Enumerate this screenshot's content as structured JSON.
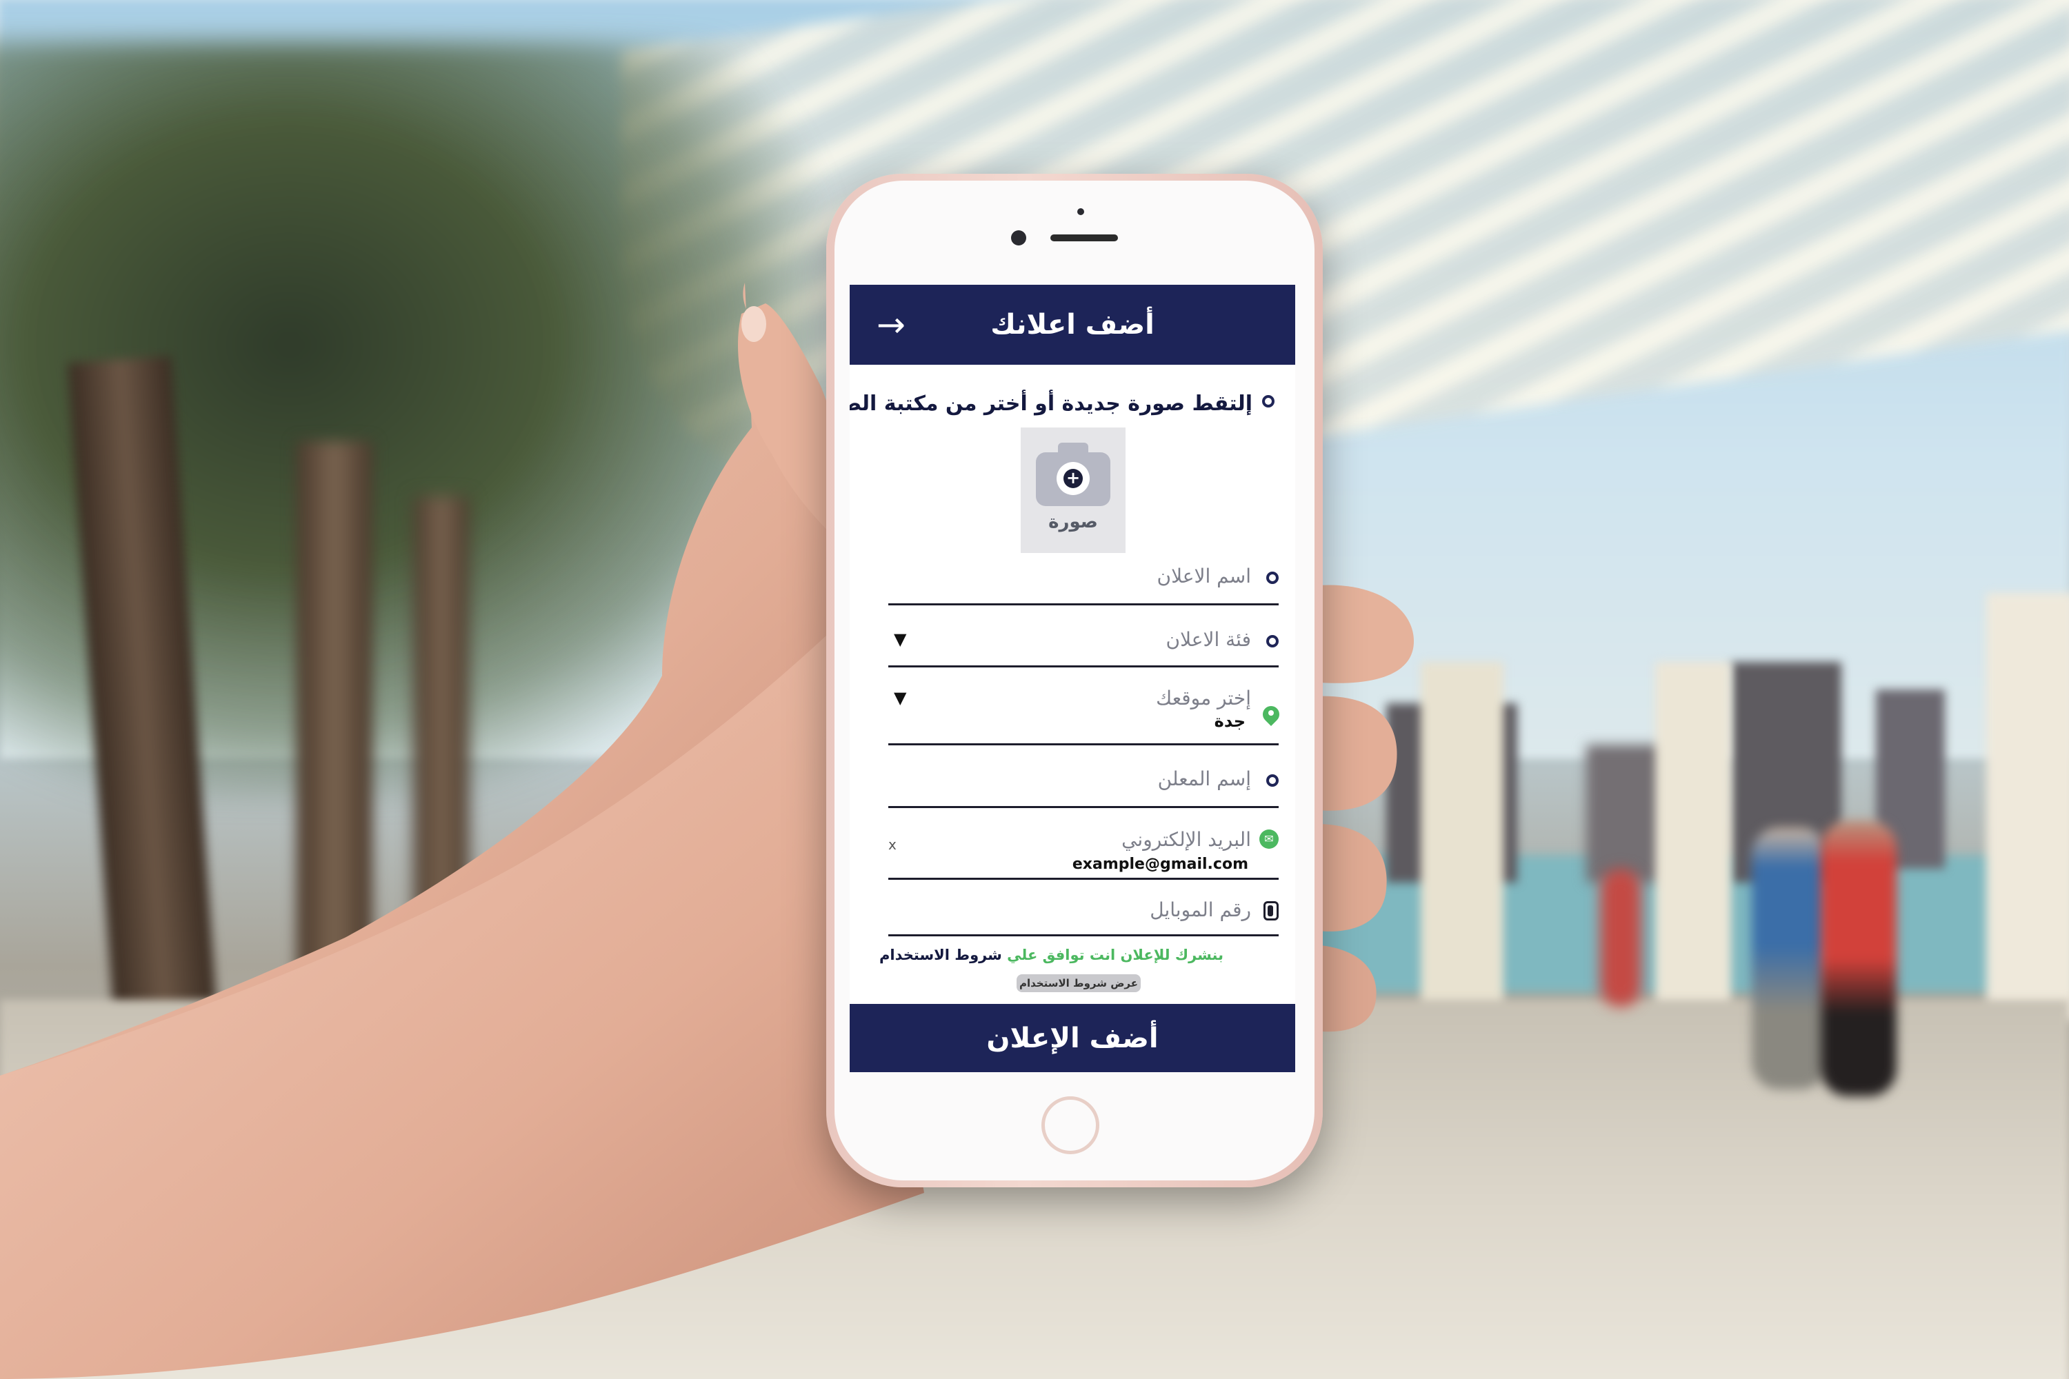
{
  "app": {
    "header_title": "أضف اعلانك",
    "back_icon": "arrow-right-icon"
  },
  "photo": {
    "instruction": "إلتقط صورة جديدة أو أختر من مكتبة الصور",
    "button_label": "صورة",
    "icon": "camera-plus-icon"
  },
  "form": {
    "ad_name_placeholder": "اسم الاعلان",
    "category_placeholder": "فئة الاعلان",
    "location_placeholder": "إختر موقعك",
    "location_value": "جدة",
    "advertiser_placeholder": "إسم المعلن",
    "email_placeholder": "البريد الإلكتروني",
    "email_value": "example@gmail.com",
    "email_clear": "x",
    "mobile_placeholder": "رقم الموبايل",
    "dropdown_caret": "▼"
  },
  "terms": {
    "text_green": "بنشرك للإعلان انت توافق علي",
    "text_link": "شروط الاستخدام",
    "view_button": "عرض شروط الاستخدام"
  },
  "submit": {
    "label": "أضف الإعلان"
  },
  "colors": {
    "primary": "#1d2458",
    "accent_green": "#4cb860",
    "phone_body": "#f3d8d0"
  }
}
